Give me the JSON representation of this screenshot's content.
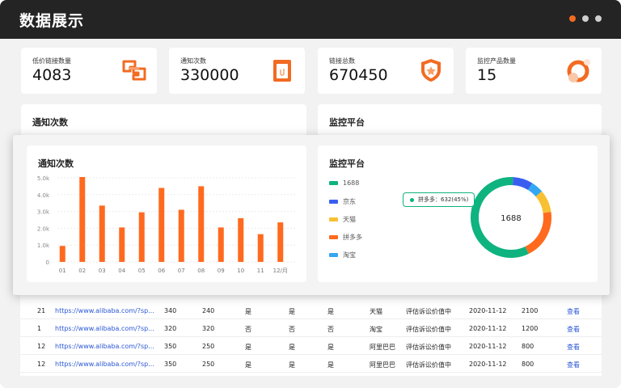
{
  "header": {
    "title": "数据展示"
  },
  "colors": {
    "accent": "#f26b22",
    "green": "#0fb37f",
    "blue": "#3a5ff0",
    "yellow": "#f7c133",
    "orange": "#ff6a1f",
    "lightblue": "#34a7f2",
    "link": "#2a57d6"
  },
  "stats": [
    {
      "label": "低价链接数量",
      "value": "4083",
      "icon": "link-icon"
    },
    {
      "label": "通知次数",
      "value": "330000",
      "icon": "clipboard-icon"
    },
    {
      "label": "链接总数",
      "value": "670450",
      "icon": "badge-icon"
    },
    {
      "label": "监控产品数量",
      "value": "15",
      "icon": "pie-icon"
    }
  ],
  "panels": {
    "notify_title": "通知次数",
    "platform_title": "监控平台"
  },
  "chart_data": [
    {
      "type": "bar",
      "title": "通知次数",
      "categories": [
        "01",
        "02",
        "03",
        "04",
        "05",
        "06",
        "07",
        "08",
        "09",
        "10",
        "11",
        "12/月"
      ],
      "values": [
        950,
        5050,
        3350,
        2050,
        2950,
        4400,
        3100,
        4500,
        2050,
        2600,
        1650,
        2350
      ],
      "ylim": [
        0,
        5000
      ],
      "yticks": [
        "0",
        "1.0k",
        "2.0k",
        "3.0k",
        "4.0k",
        "5.0k"
      ],
      "grid": true
    },
    {
      "type": "pie",
      "title": "监控平台",
      "center_label": "1688",
      "legend": [
        "1688",
        "京东",
        "天猫",
        "拼多多",
        "淘宝"
      ],
      "values": [
        58,
        8,
        9,
        20,
        5
      ],
      "tooltip": "拼多多：632(45%)",
      "legend_position": "left"
    }
  ],
  "table": {
    "rows": [
      [
        "21",
        "https://www.alibaba.com/?sp...",
        "340",
        "240",
        "是",
        "是",
        "是",
        "天猫",
        "评估诉讼价值中",
        "2020-11-12",
        "2100",
        "查看"
      ],
      [
        "1",
        "https://www.alibaba.com/?sp...",
        "320",
        "320",
        "否",
        "否",
        "否",
        "淘宝",
        "评估诉讼价值中",
        "2020-11-12",
        "1200",
        "查看"
      ],
      [
        "12",
        "https://www.alibaba.com/?sp...",
        "350",
        "250",
        "是",
        "是",
        "是",
        "阿里巴巴",
        "评估诉讼价值中",
        "2020-11-12",
        "800",
        "查看"
      ],
      [
        "12",
        "https://www.alibaba.com/?sp...",
        "350",
        "250",
        "是",
        "是",
        "是",
        "阿里巴巴",
        "评估诉讼价值中",
        "2020-11-12",
        "800",
        "查看"
      ]
    ]
  }
}
